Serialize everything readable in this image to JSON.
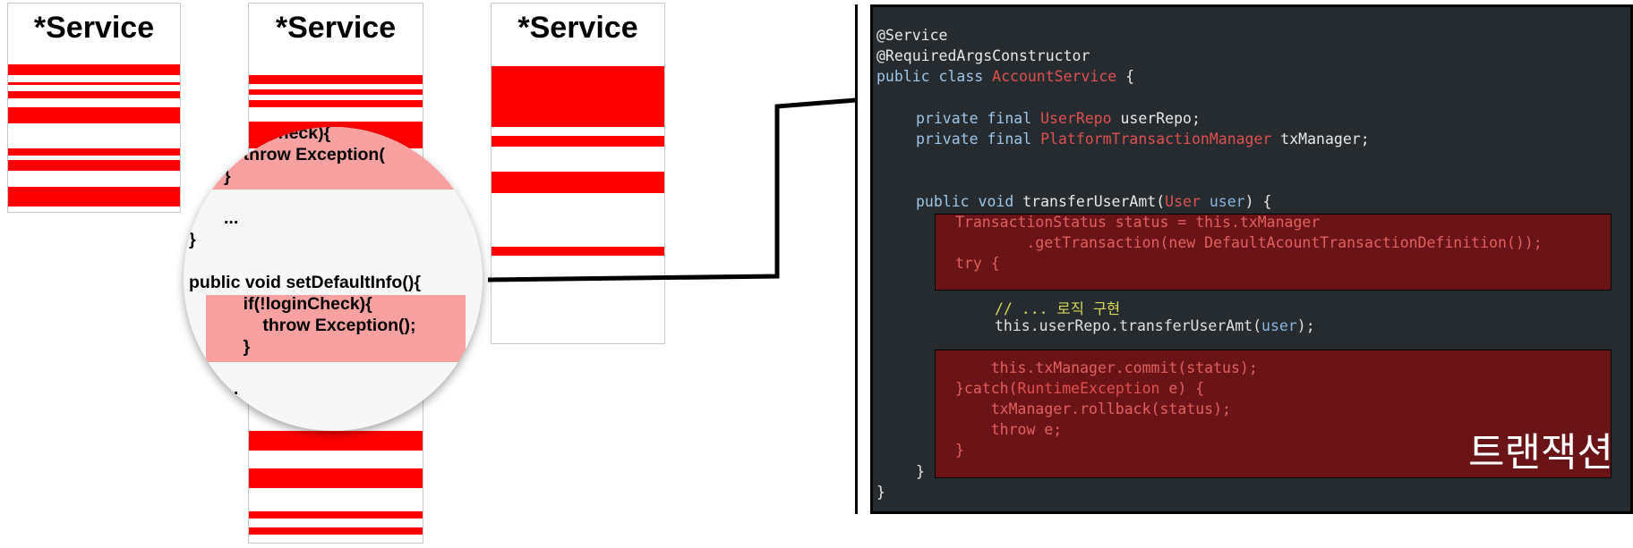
{
  "columns": [
    {
      "title": "*Service"
    },
    {
      "title": "*Service"
    },
    {
      "title": "*Service"
    }
  ],
  "lens": {
    "lines": [
      "loginCheck){",
      "    throw Exception(",
      "}",
      "...",
      "}",
      "public void setDefaultInfo(){",
      "    if(!loginCheck){",
      "        throw Exception();",
      "    }",
      "..."
    ]
  },
  "code": {
    "l1": "@Service",
    "l2": "@RequiredArgsConstructor",
    "l3_kw": "public class ",
    "l3_cls": "AccountService",
    "l3_end": " {",
    "l4_kw": "private final ",
    "l4_cls": "UserRepo",
    "l4_end": " userRepo;",
    "l5_kw": "private final ",
    "l5_cls": "PlatformTransactionManager",
    "l5_end": " txManager;",
    "l6_kw": "public void ",
    "l6_fn": "transferUserAmt(",
    "l6_cls": "User",
    "l6_param": " user",
    "l6_end": ") {",
    "b1_l1": "TransactionStatus status = this.txManager",
    "b1_l2": "        .getTransaction(new DefaultAcountTransactionDefinition());",
    "b1_l3": "try {",
    "c1": "// ... 로직 구현",
    "c2_a": "this.userRepo.transferUserAmt(",
    "c2_b": "user",
    "c2_c": ");",
    "b2_l1": "    this.txManager.commit(status);",
    "b2_l2a": "}catch(",
    "b2_l2b": "RuntimeException",
    "b2_l2c": " e) {",
    "b2_l3": "    txManager.rollback(status);",
    "b2_l4": "    throw e;",
    "b2_l5": "}",
    "close1": "}",
    "close2": "}"
  },
  "badge": "트랜잭션",
  "colors": {
    "band": "#ff0000",
    "lens_highlight": "#f9a0a0",
    "code_bg": "#252b2f",
    "block_bg": "#6b1418"
  }
}
